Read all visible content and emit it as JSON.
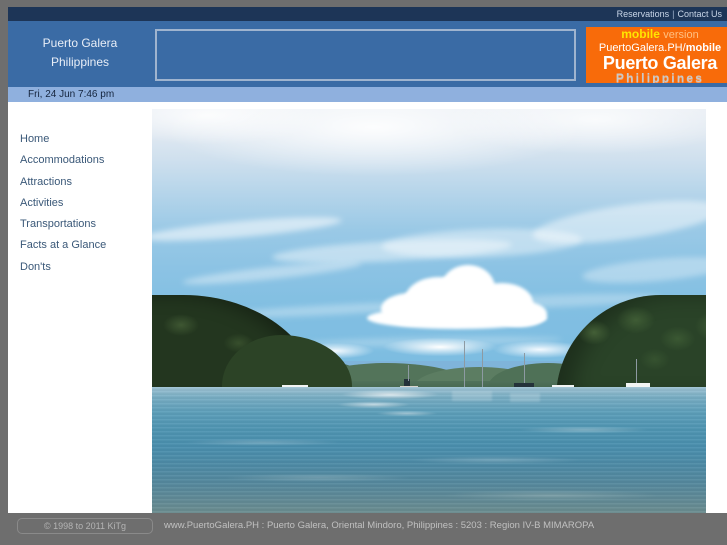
{
  "topbar": {
    "reservations": "Reservations",
    "separator": "|",
    "contact": "Contact Us"
  },
  "header": {
    "site_title_line1": "Puerto Galera",
    "site_title_line2": "Philippines",
    "banner_placeholder": ""
  },
  "logo": {
    "mobile": "mobile",
    "version": "version",
    "url": "PuertoGalera.PH/",
    "url_bold": "mobile",
    "brand": "Puerto Galera",
    "country": "Philippines",
    "background_color": "#f86b0a",
    "mobile_color": "#ffe600"
  },
  "datebar": {
    "date": "Fri, 24 Jun 7:46 pm"
  },
  "nav": {
    "items": [
      {
        "label": "Home"
      },
      {
        "label": "Accommodations"
      },
      {
        "label": "Attractions"
      },
      {
        "label": "Activities"
      },
      {
        "label": "Transportations"
      },
      {
        "label": "Facts at a Glance"
      },
      {
        "label": "Don'ts"
      }
    ]
  },
  "photo": {
    "alt": "Puerto Galera bay with sailboats, forested headlands, blue sky and calm water"
  },
  "footer": {
    "copyright": "© 1998 to 2011 KiTg",
    "address": "www.PuertoGalera.PH : Puerto Galera, Oriental Mindoro, Philippines : 5203 : Region IV-B MIMAROPA"
  },
  "colors": {
    "page_margin": "#6e6e6e",
    "topbar": "#1d3557",
    "header": "#3a6ba5",
    "datebar": "#8fb0de",
    "nav_link": "#3a5878"
  }
}
